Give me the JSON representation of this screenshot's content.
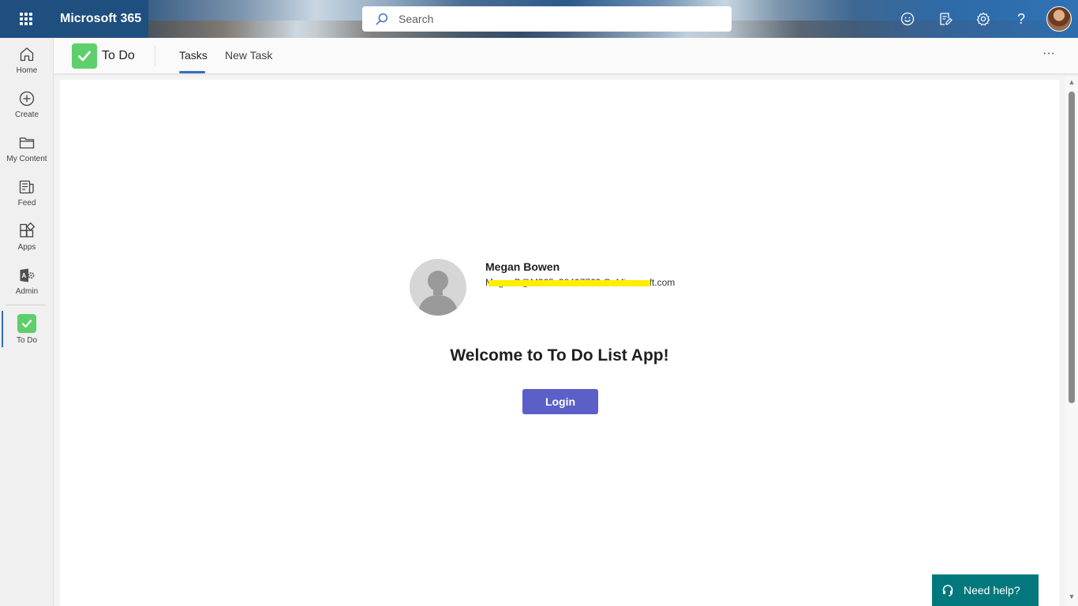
{
  "header": {
    "app_name": "Microsoft 365",
    "search_placeholder": "Search",
    "icons": [
      "waffle-icon",
      "search-icon",
      "feedback-icon",
      "whats-new-icon",
      "settings-icon",
      "help-icon",
      "user-avatar"
    ],
    "help_glyph": "?"
  },
  "rail": {
    "items": [
      {
        "label": "Home",
        "icon": "home-icon"
      },
      {
        "label": "Create",
        "icon": "create-icon"
      },
      {
        "label": "My Content",
        "icon": "folder-icon"
      },
      {
        "label": "Feed",
        "icon": "feed-icon"
      },
      {
        "label": "Apps",
        "icon": "apps-icon"
      },
      {
        "label": "Admin",
        "icon": "admin-icon"
      },
      {
        "label": "To Do",
        "icon": "todo-icon",
        "active": true
      }
    ]
  },
  "app": {
    "title": "To Do",
    "tabs": [
      {
        "label": "Tasks",
        "active": true
      },
      {
        "label": "New Task",
        "active": false
      }
    ],
    "more_label": "···"
  },
  "profile": {
    "name": "Megan Bowen",
    "email": "MeganB@M365x38407769.OnMicrosoft.com"
  },
  "main": {
    "welcome": "Welcome to To Do List App!",
    "login_label": "Login"
  },
  "help": {
    "label": "Need help?"
  },
  "colors": {
    "brand_blue": "#1e4f7e",
    "accent_blue": "#2f6fc0",
    "todo_green": "#5ecf6b",
    "login_purple": "#5b5fc7",
    "help_teal": "#03787c",
    "redaction_yellow": "#ffee00"
  }
}
